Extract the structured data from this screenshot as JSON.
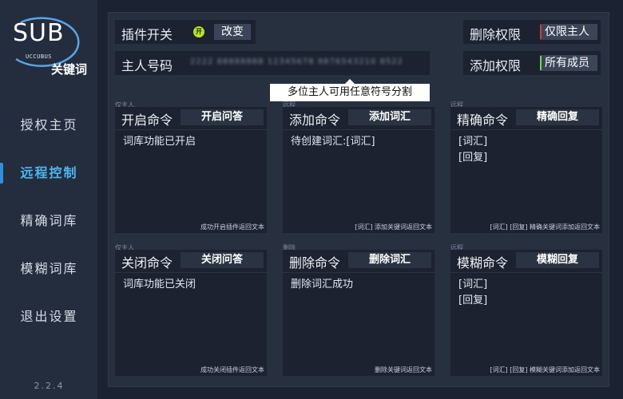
{
  "sidebar": {
    "logo": {
      "big": "SUB",
      "small": "UCCUBUS",
      "keyword": "关键词"
    },
    "items": [
      {
        "label": "授权主页",
        "active": false
      },
      {
        "label": "远程控制",
        "active": true
      },
      {
        "label": "精确词库",
        "active": false
      },
      {
        "label": "模糊词库",
        "active": false
      },
      {
        "label": "退出设置",
        "active": false
      }
    ],
    "version": "2.2.4"
  },
  "header": {
    "plugin_switch_label": "插件开关",
    "plugin_switch_state": "开",
    "change_button": "改变",
    "delete_perm_label": "删除权限",
    "delete_perm_value": "仅限主人",
    "delete_perm_color": "#d9363e",
    "owner_label": "主人号码",
    "owner_value": "2222 88888888 12345678 9876543210 8522",
    "owner_tooltip": "多位主人可用任意符号分割",
    "add_perm_label": "添加权限",
    "add_perm_value": "所有成员",
    "add_perm_color": "#6fdc3c"
  },
  "cards": [
    {
      "tag": "仅主人",
      "title": "开启命令",
      "button": "开启问答",
      "content": [
        "词库功能已开启"
      ],
      "footer": "成功开启插件返回文本"
    },
    {
      "tag": "远程",
      "title": "添加命令",
      "button": "添加词汇",
      "content": [
        "待创建词汇:[词汇]"
      ],
      "footer": "[词汇] 添加关键词返回文本"
    },
    {
      "tag": "远程",
      "title": "精确命令",
      "button": "精确回复",
      "content": [
        "[词汇]",
        "[回复]"
      ],
      "footer": "[词汇] [回复] 精确关键词添加返回文本"
    },
    {
      "tag": "仅主人",
      "title": "关闭命令",
      "button": "关闭问答",
      "content": [
        "词库功能已关闭"
      ],
      "footer": "成功关闭插件返回文本"
    },
    {
      "tag": "删除",
      "title": "删除命令",
      "button": "删除词汇",
      "content": [
        "删除词汇成功"
      ],
      "footer": "删除关键词返回文本"
    },
    {
      "tag": "远程",
      "title": "模糊命令",
      "button": "模糊回复",
      "content": [
        "[词汇]",
        "[回复]"
      ],
      "footer": "[词汇] [回复] 模糊关键词添加返回文本"
    }
  ]
}
